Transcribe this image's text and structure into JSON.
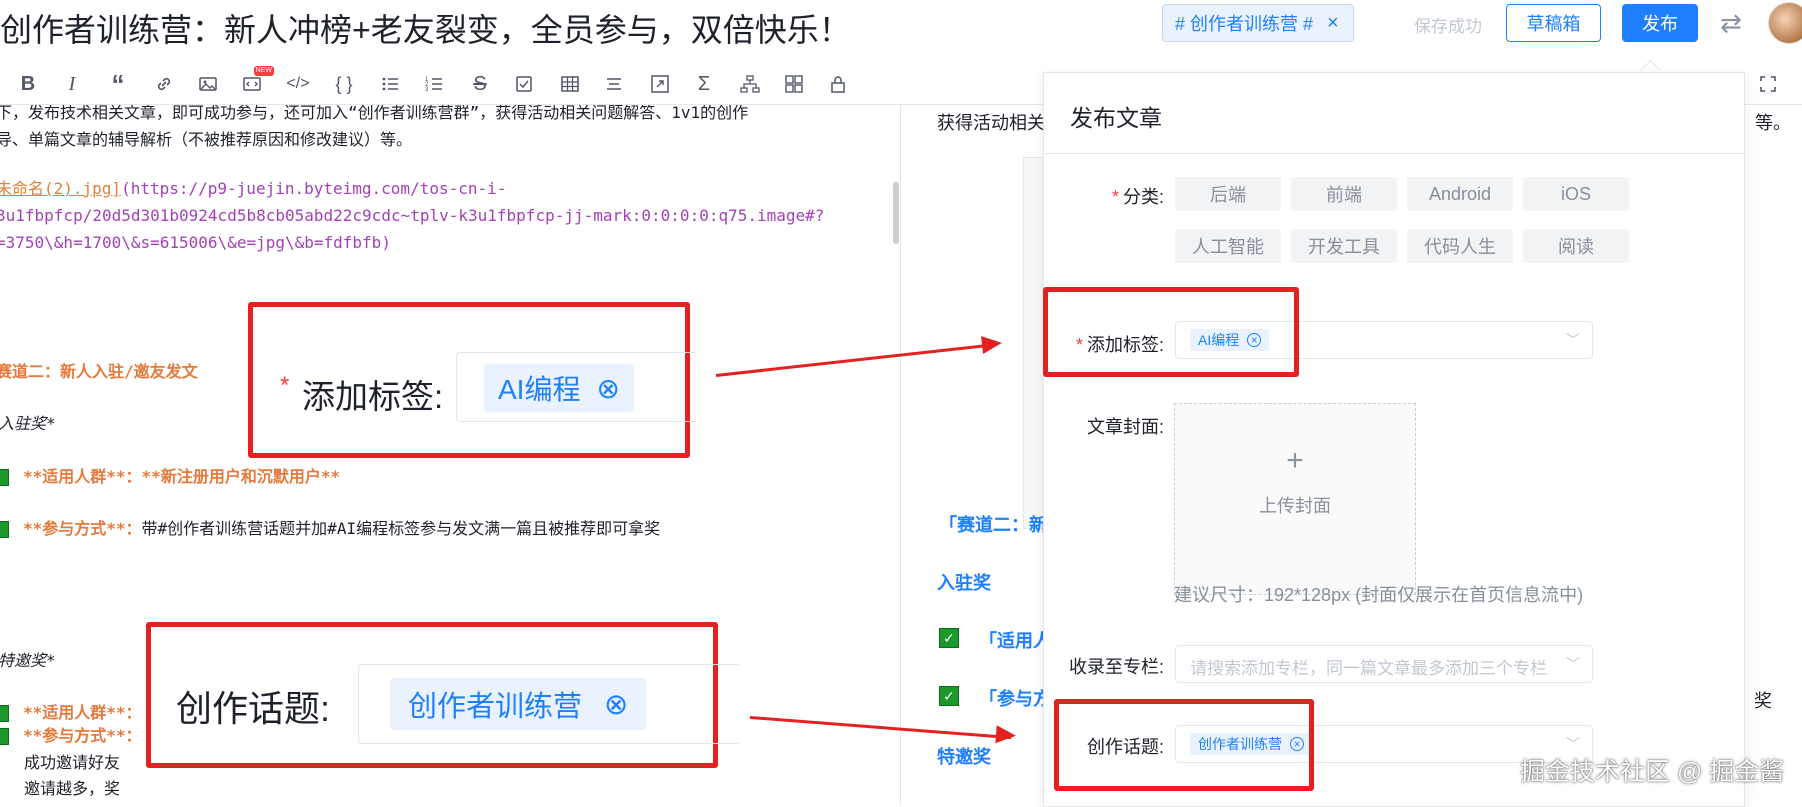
{
  "header": {
    "title": "创作者训练营：新人冲榜+老友裂变，全员参与，双倍快乐！",
    "topic_chip": "# 创作者训练营 #",
    "topic_close": "×",
    "save_status": "保存成功",
    "draft_button": "草稿箱",
    "publish_button": "发布"
  },
  "toolbar": {
    "new_badge": "NEW"
  },
  "editor": {
    "lines": [
      "下，发布技术相关文章，即可成功参与，还可加入“创作者训练营群”，获得活动相关问题解答、1v1的创作",
      "导、单篇文章的辅导解析（不被推荐原因和修改建议）等。"
    ],
    "image_link": "未命名(2).jpg]",
    "url_1": "(https://p9-juejin.byteimg.com/tos-cn-i-",
    "url_2": "3u1fbpfcp/20d5d301b0924cd5b8cb05abd22c9cdc~tplv-k3u1fbpfcp-jj-mark:0:0:0:0:q75.image#?",
    "url_3": "=3750\\&h=1700\\&s=615006\\&e=jpg\\&b=fdfbfb)",
    "track2_heading": "赛道二：新人入驻/邀友发文",
    "settle_award": "入驻奖*",
    "item1_label": "**适用人群**：",
    "item1_value": "**新注册用户和沉默用户**",
    "item2_label": "**参与方式**：",
    "item2_value": "带#创作者训练营话题并加#AI编程标签参与发文满一篇且被推荐即可拿奖",
    "invite_award": "特邀奖*",
    "item3_label": "**适用人群**：",
    "item4_label": "**参与方式**：",
    "line_a": "成功邀请好友",
    "line_b": "邀请越多，奖"
  },
  "preview": {
    "top_text_left": "获得活动相关",
    "top_text_right": "等。",
    "track2": "「赛道二：新",
    "settle_award": "入驻奖",
    "item1": "「适用人",
    "item2": "「参与方",
    "invite_award": "特邀奖",
    "right_fragment": "奖"
  },
  "zoom_tag": {
    "label": "添加标签:",
    "required": "*",
    "chip": "AI编程",
    "close": "⊗"
  },
  "zoom_topic": {
    "label": "创作话题:",
    "chip": "创作者训练营",
    "close": "⊗"
  },
  "publish_panel": {
    "title": "发布文章",
    "category_label": "分类:",
    "categories": [
      "后端",
      "前端",
      "Android",
      "iOS",
      "人工智能",
      "开发工具",
      "代码人生",
      "阅读"
    ],
    "tag_label": "添加标签:",
    "tag_chip": "AI编程",
    "cover_label": "文章封面:",
    "upload_plus": "+",
    "upload_text": "上传封面",
    "size_hint": "建议尺寸：192*128px (封面仅展示在首页信息流中)",
    "column_label": "收录至专栏:",
    "column_placeholder": "请搜索添加专栏，同一篇文章最多添加三个专栏",
    "topic_label": "创作话题:",
    "topic_chip": "创作者训练营",
    "required_mark": "*",
    "chip_close": "⊗",
    "chevron": "﹀"
  },
  "watermark": "掘金技术社区 @ 掘金酱",
  "colors": {
    "accent": "#1e80ff",
    "callout_red": "#e52020",
    "orange_markdown": "#e6793b",
    "url_purple": "#a341b8",
    "check_green": "#1a9a2a"
  }
}
